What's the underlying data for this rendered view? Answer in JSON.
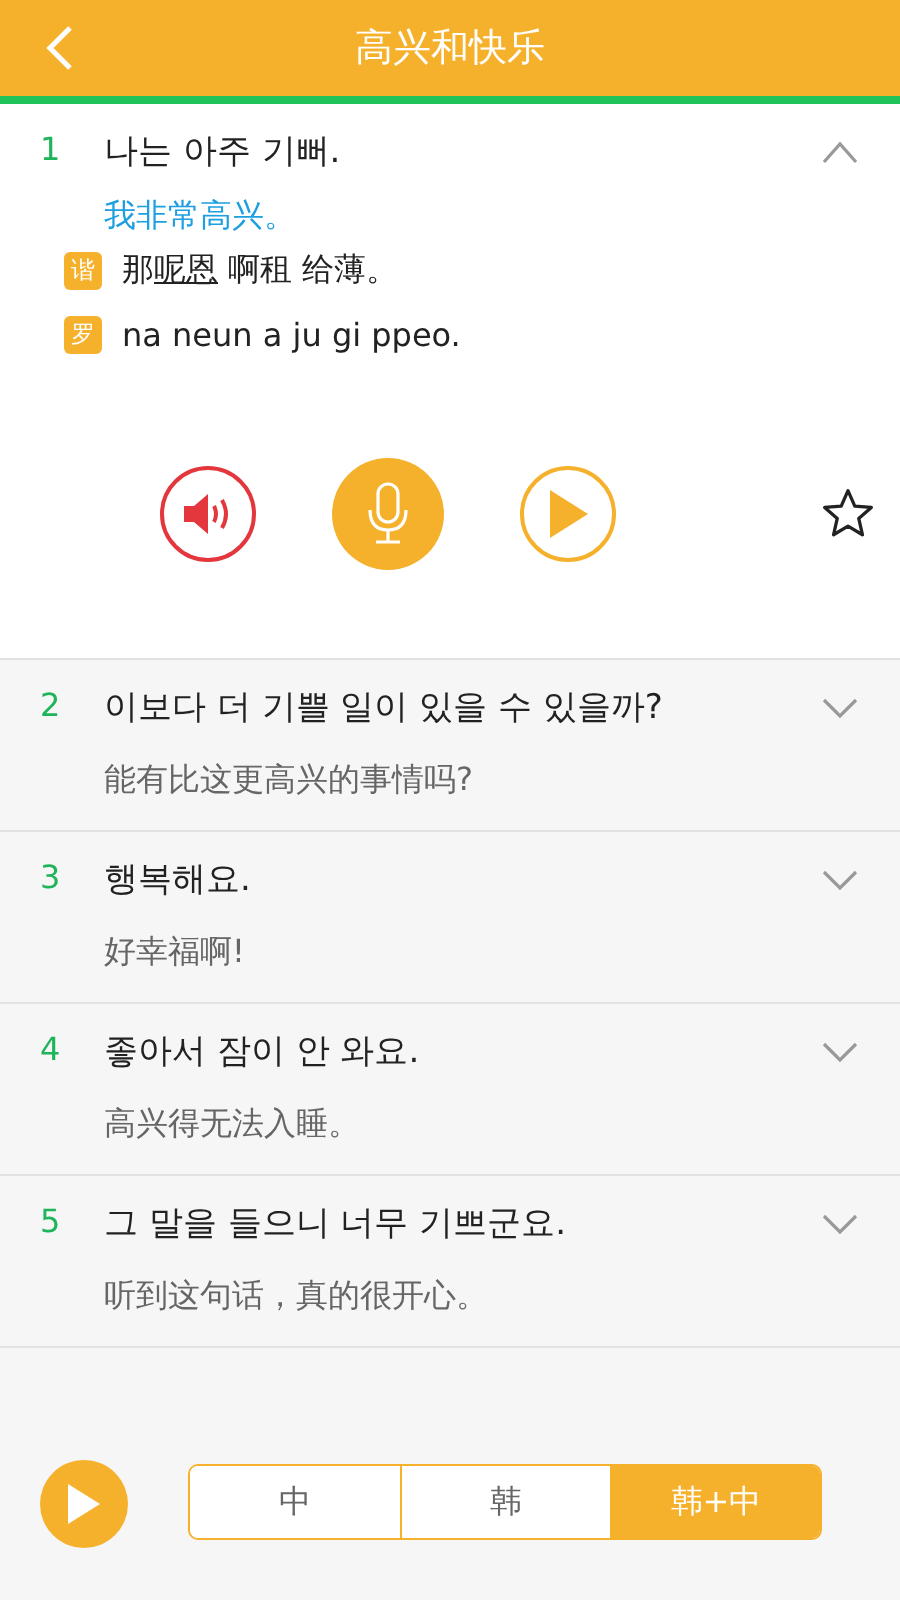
{
  "header": {
    "title": "高兴和快乐"
  },
  "sentences": [
    {
      "number": "1",
      "korean": "나는 아주 기뻐.",
      "chinese": "我非常高兴。",
      "expanded": true,
      "favorite": false,
      "homophone": {
        "tag": "谐",
        "parts": [
          {
            "text": "那",
            "underlined": false
          },
          {
            "text": "呢恩",
            "underlined": true
          },
          {
            "text": " 啊租 给薄。",
            "underlined": false
          }
        ]
      },
      "romanization": {
        "tag": "罗",
        "text": "na neun a ju gi ppeo."
      }
    },
    {
      "number": "2",
      "korean": "이보다 더 기쁠 일이 있을 수 있을까?",
      "chinese": "能有比这更高兴的事情吗?",
      "expanded": false
    },
    {
      "number": "3",
      "korean": "행복해요.",
      "chinese": "好幸福啊!",
      "expanded": false
    },
    {
      "number": "4",
      "korean": "좋아서 잠이 안 와요.",
      "chinese": "高兴得无法入睡。",
      "expanded": false
    },
    {
      "number": "5",
      "korean": "그 말을 들으니 너무 기쁘군요.",
      "chinese": "听到这句话，真的很开心。",
      "expanded": false
    }
  ],
  "modes": [
    {
      "label": "中",
      "selected": false
    },
    {
      "label": "韩",
      "selected": false
    },
    {
      "label": "韩+中",
      "selected": true
    }
  ]
}
